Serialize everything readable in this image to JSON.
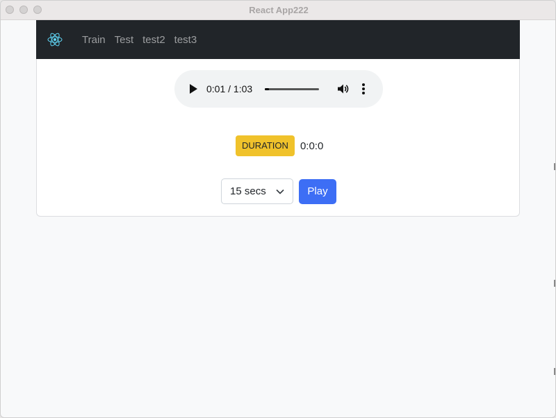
{
  "window": {
    "title": "React App222"
  },
  "navbar": {
    "logo_icon": "react-atom-icon",
    "links": [
      {
        "label": "Train"
      },
      {
        "label": "Test"
      },
      {
        "label": "test2"
      },
      {
        "label": "test3"
      }
    ]
  },
  "audio": {
    "time_display": "0:01 / 1:03",
    "progress_fraction": 0.016,
    "icons": {
      "play": "play-icon",
      "volume": "volume-icon",
      "more": "more-vertical-icon"
    }
  },
  "duration": {
    "badge_label": "DURATION",
    "value": "0:0:0"
  },
  "controls": {
    "select_value": "15 secs",
    "play_label": "Play"
  },
  "colors": {
    "navbar_bg": "#212529",
    "badge_bg": "#f0c22b",
    "button_bg": "#3d6ef5",
    "react_blue": "#61dafb"
  }
}
